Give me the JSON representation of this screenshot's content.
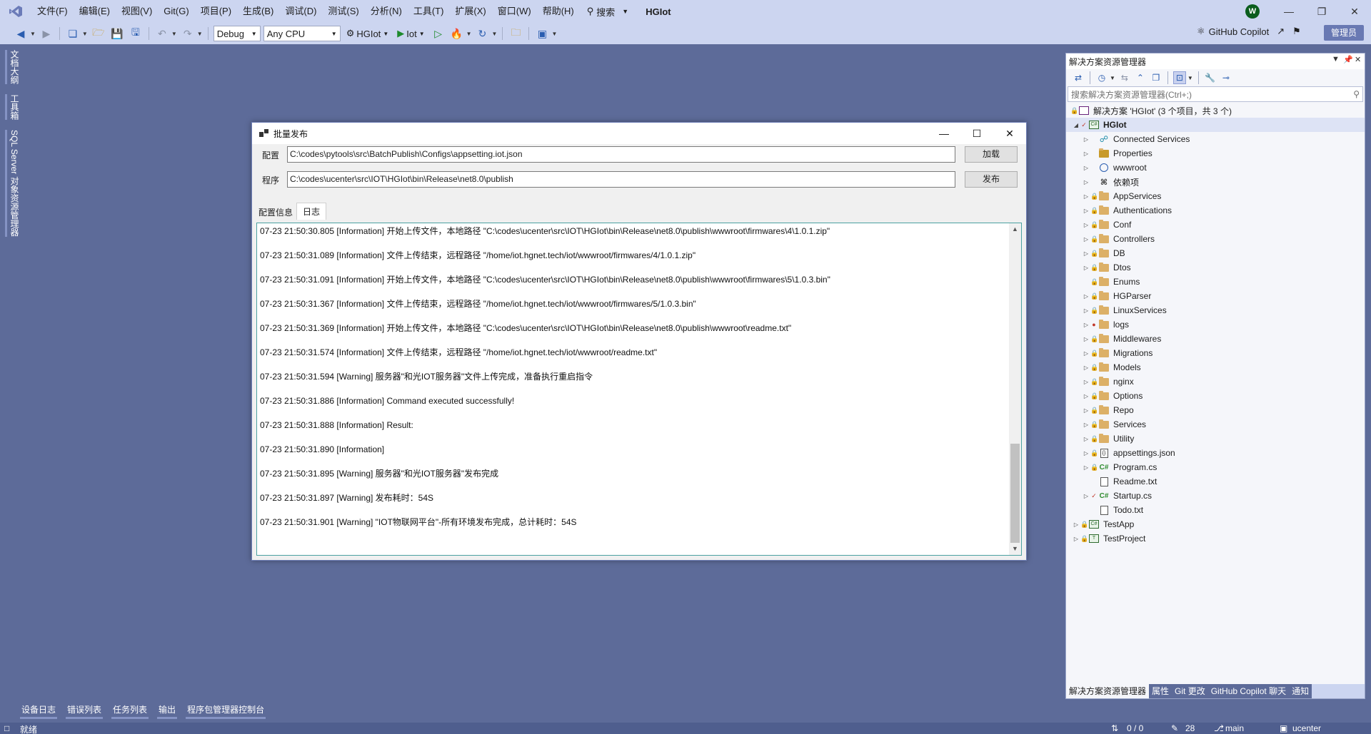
{
  "menubar": {
    "items": [
      "文件(F)",
      "编辑(E)",
      "视图(V)",
      "Git(G)",
      "项目(P)",
      "生成(B)",
      "调试(D)",
      "测试(S)",
      "分析(N)",
      "工具(T)",
      "扩展(X)",
      "窗口(W)",
      "帮助(H)"
    ],
    "search_label": "搜索",
    "app_title": "HGIot",
    "avatar_initial": "W"
  },
  "toolbar": {
    "config_value": "Debug",
    "platform_value": "Any CPU",
    "startup_project": "HGIot",
    "run_target": "Iot",
    "copilot_label": "GitHub Copilot",
    "admin_label": "管理员"
  },
  "left_tabs": [
    "文档大纲",
    "工具箱",
    "SQL Server 对象资源管理器"
  ],
  "dialog": {
    "title": "批量发布",
    "config_label": "配置",
    "config_path": "C:\\codes\\pytools\\src\\BatchPublish\\Configs\\appsetting.iot.json",
    "load_button": "加载",
    "program_label": "程序",
    "program_path": "C:\\codes\\ucenter\\src\\IOT\\HGIot\\bin\\Release\\net8.0\\publish",
    "publish_button": "发布",
    "tabs": [
      "配置信息",
      "日志"
    ],
    "log_lines": [
      "07-23 21:50:30.805 [Information] 开始上传文件，本地路径 \"C:\\codes\\ucenter\\src\\IOT\\HGIot\\bin\\Release\\net8.0\\publish\\wwwroot\\firmwares\\4\\1.0.1.zip\"",
      "07-23 21:50:31.089 [Information] 文件上传结束，远程路径 \"/home/iot.hgnet.tech/iot/wwwroot/firmwares/4/1.0.1.zip\"",
      "07-23 21:50:31.091 [Information] 开始上传文件，本地路径 \"C:\\codes\\ucenter\\src\\IOT\\HGIot\\bin\\Release\\net8.0\\publish\\wwwroot\\firmwares\\5\\1.0.3.bin\"",
      "07-23 21:50:31.367 [Information] 文件上传结束，远程路径 \"/home/iot.hgnet.tech/iot/wwwroot/firmwares/5/1.0.3.bin\"",
      "07-23 21:50:31.369 [Information] 开始上传文件，本地路径 \"C:\\codes\\ucenter\\src\\IOT\\HGIot\\bin\\Release\\net8.0\\publish\\wwwroot\\readme.txt\"",
      "07-23 21:50:31.574 [Information] 文件上传结束，远程路径 \"/home/iot.hgnet.tech/iot/wwwroot/readme.txt\"",
      "07-23 21:50:31.594 [Warning] 服务器\"和光IOT服务器\"文件上传完成，准备执行重启指令",
      "07-23 21:50:31.886 [Information] Command executed successfully!",
      "07-23 21:50:31.888 [Information] Result:",
      "07-23 21:50:31.890 [Information]",
      "07-23 21:50:31.895 [Warning] 服务器\"和光IOT服务器\"发布完成",
      "07-23 21:50:31.897 [Warning] 发布耗时：54S",
      "07-23 21:50:31.901 [Warning] \"IOT物联网平台\"-所有环境发布完成，总计耗时：54S"
    ]
  },
  "solution_explorer": {
    "title": "解决方案资源管理器",
    "search_placeholder": "搜索解决方案资源管理器(Ctrl+;)",
    "solution_label": "解决方案 'HGIot' (3 个项目，共 3 个)",
    "project": "HGIot",
    "items": [
      {
        "label": "Connected Services",
        "icon": "connected-services-icon"
      },
      {
        "label": "Properties",
        "icon": "properties-folder-icon"
      },
      {
        "label": "wwwroot",
        "icon": "globe-icon"
      },
      {
        "label": "依赖项",
        "icon": "dependencies-icon"
      },
      {
        "label": "AppServices",
        "icon": "folder-icon"
      },
      {
        "label": "Authentications",
        "icon": "folder-icon"
      },
      {
        "label": "Conf",
        "icon": "folder-icon"
      },
      {
        "label": "Controllers",
        "icon": "folder-icon"
      },
      {
        "label": "DB",
        "icon": "folder-icon"
      },
      {
        "label": "Dtos",
        "icon": "folder-icon"
      },
      {
        "label": "Enums",
        "icon": "folder-icon"
      },
      {
        "label": "HGParser",
        "icon": "folder-icon"
      },
      {
        "label": "LinuxServices",
        "icon": "folder-icon"
      },
      {
        "label": "logs",
        "icon": "folder-icon"
      },
      {
        "label": "Middlewares",
        "icon": "folder-icon"
      },
      {
        "label": "Migrations",
        "icon": "folder-icon"
      },
      {
        "label": "Models",
        "icon": "folder-icon"
      },
      {
        "label": "nginx",
        "icon": "folder-icon"
      },
      {
        "label": "Options",
        "icon": "folder-icon"
      },
      {
        "label": "Repo",
        "icon": "folder-icon"
      },
      {
        "label": "Services",
        "icon": "folder-icon"
      },
      {
        "label": "Utility",
        "icon": "folder-icon"
      },
      {
        "label": "appsettings.json",
        "icon": "json-file-icon"
      },
      {
        "label": "Program.cs",
        "icon": "csharp-file-icon"
      },
      {
        "label": "Readme.txt",
        "icon": "text-file-icon"
      },
      {
        "label": "Startup.cs",
        "icon": "csharp-file-icon"
      },
      {
        "label": "Todo.txt",
        "icon": "text-file-icon"
      }
    ],
    "other_projects": [
      "TestApp",
      "TestProject"
    ],
    "bottom_tabs": [
      "解决方案资源管理器",
      "属性",
      "Git 更改",
      "GitHub Copilot 聊天",
      "通知"
    ]
  },
  "bottom_tabs": [
    "设备日志",
    "错误列表",
    "任务列表",
    "输出",
    "程序包管理器控制台"
  ],
  "statusbar": {
    "ready": "就绪",
    "line_col": "0 / 0",
    "changes": "28",
    "branch": "main",
    "repo": "ucenter"
  }
}
